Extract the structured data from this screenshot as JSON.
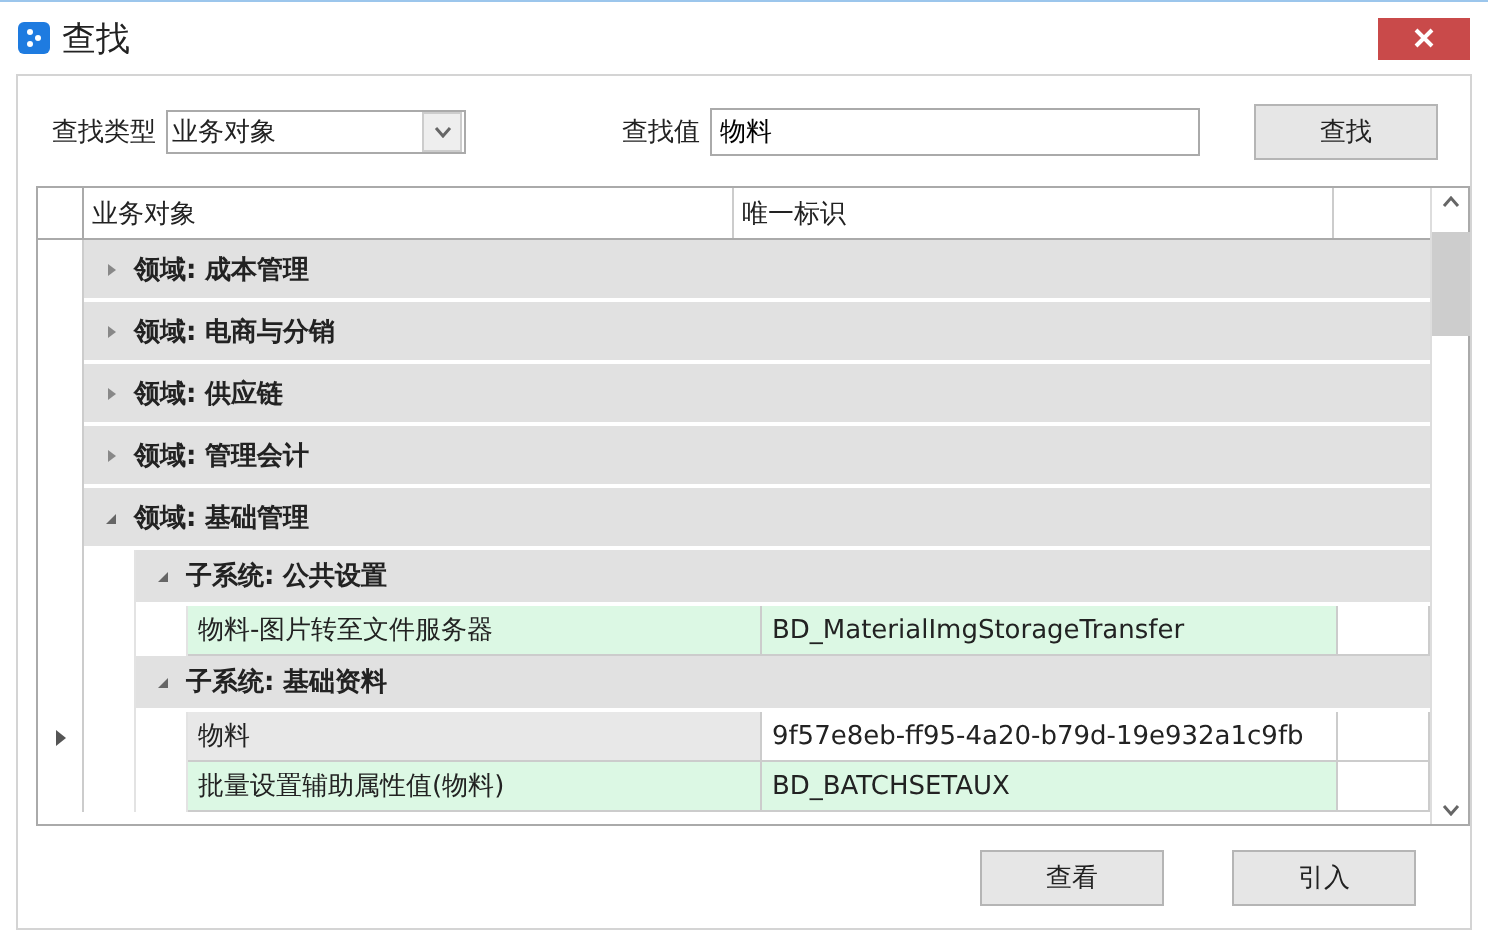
{
  "window": {
    "title": "查找"
  },
  "search": {
    "type_label": "查找类型",
    "type_value": "业务对象",
    "value_label": "查找值",
    "value": "物料",
    "button": "查找"
  },
  "table": {
    "columns": [
      "业务对象",
      "唯一标识"
    ],
    "tree": [
      {
        "label": "领域: 成本管理",
        "expanded": false
      },
      {
        "label": "领域: 电商与分销",
        "expanded": false
      },
      {
        "label": "领域: 供应链",
        "expanded": false
      },
      {
        "label": "领域: 管理会计",
        "expanded": false
      },
      {
        "label": "领域: 基础管理",
        "expanded": true,
        "children": [
          {
            "label": "子系统: 公共设置",
            "expanded": true,
            "children": [
              {
                "name": "物料-图片转至文件服务器",
                "id": "BD_MaterialImgStorageTransfer",
                "selected": false
              }
            ]
          },
          {
            "label": "子系统: 基础资料",
            "expanded": true,
            "children": [
              {
                "name": "物料",
                "id": "9f57e8eb-ff95-4a20-b79d-19e932a1c9fb",
                "selected": true
              },
              {
                "name": "批量设置辅助属性值(物料)",
                "id": "BD_BATCHSETAUX",
                "selected": false
              }
            ]
          }
        ]
      }
    ]
  },
  "buttons": [
    "查看",
    "引入"
  ]
}
